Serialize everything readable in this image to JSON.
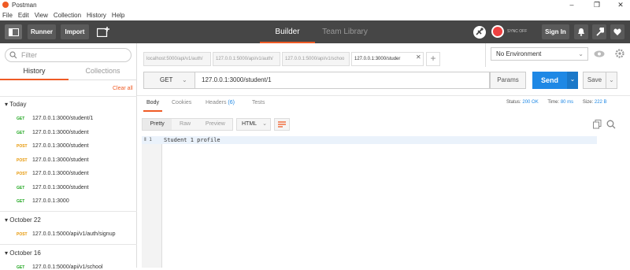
{
  "titlebar": {
    "title": "Postman",
    "minimize": "–",
    "maximize": "❐",
    "close": "✕"
  },
  "menu": [
    "File",
    "Edit",
    "View",
    "Collection",
    "History",
    "Help"
  ],
  "toolbar": {
    "runner": "Runner",
    "import": "Import",
    "builder": "Builder",
    "team_library": "Team Library",
    "sync_status": "SYNC OFF",
    "sign_in": "Sign In"
  },
  "sidebar": {
    "filter_placeholder": "Filter",
    "tabs": {
      "history": "History",
      "collections": "Collections"
    },
    "clear_all": "Clear all",
    "groups": [
      {
        "label": "Today",
        "items": [
          {
            "method": "GET",
            "url": "127.0.0.1:3000/student/1"
          },
          {
            "method": "GET",
            "url": "127.0.0.1:3000/student"
          },
          {
            "method": "POST",
            "url": "127.0.0.1:3000/student"
          },
          {
            "method": "POST",
            "url": "127.0.0.1:3000/student"
          },
          {
            "method": "POST",
            "url": "127.0.0.1:3000/student"
          },
          {
            "method": "GET",
            "url": "127.0.0.1:3000/student"
          },
          {
            "method": "GET",
            "url": "127.0.0.1:3000"
          }
        ]
      },
      {
        "label": "October 22",
        "items": [
          {
            "method": "POST",
            "url": "127.0.0.1:5000/api/v1/auth/signup"
          }
        ]
      },
      {
        "label": "October 16",
        "items": [
          {
            "method": "GET",
            "url": "127.0.0.1:5000/api/v1/school"
          }
        ]
      }
    ]
  },
  "request_tabs": [
    {
      "label": "localhost:5000/api/v1/auth/"
    },
    {
      "label": "127.0.0.1:5000/api/v1/auth/"
    },
    {
      "label": "127.0.0.1:5000/api/v1/schoo"
    },
    {
      "label": "127.0.0.1:3000/studer",
      "close": "✕"
    }
  ],
  "add_tab": "+",
  "environment": {
    "selected": "No Environment"
  },
  "request": {
    "method": "GET",
    "url": "127.0.0.1:3000/student/1",
    "params": "Params",
    "send": "Send",
    "save": "Save"
  },
  "response": {
    "tabs": {
      "body": "Body",
      "cookies": "Cookies",
      "headers": "Headers",
      "headers_count": "(6)",
      "tests": "Tests"
    },
    "status_label": "Status:",
    "status": "200 OK",
    "time_label": "Time:",
    "time": "80 ms",
    "size_label": "Size:",
    "size": "222 B",
    "view_modes": {
      "pretty": "Pretty",
      "raw": "Raw",
      "preview": "Preview"
    },
    "format": "HTML",
    "line_number": "1",
    "body_text": "Student 1 profile"
  },
  "colors": {
    "accent": "#ef5b25",
    "send": "#1e88e5",
    "toolbar": "#464646",
    "get": "#1ea61e",
    "post": "#e69500",
    "status": "#1e88e5"
  }
}
